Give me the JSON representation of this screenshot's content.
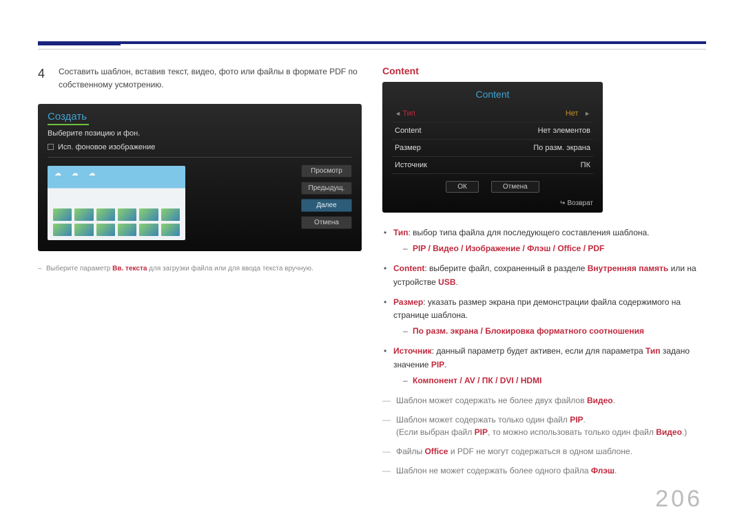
{
  "page_number": "206",
  "left": {
    "step_number": "4",
    "step_text": "Составить шаблон, вставив текст, видео, фото или файлы в формате PDF по собственному усмотрению.",
    "screen": {
      "title": "Создать",
      "instruction": "Выберите позицию и фон.",
      "checkbox_label": "Исп. фоновое изображение",
      "buttons": {
        "preview": "Просмотр",
        "prev": "Предыдущ.",
        "next": "Далее",
        "cancel": "Отмена"
      }
    },
    "caption_before_em": "Выберите параметр ",
    "caption_em": "Вв. текста",
    "caption_after_em": " для загрузки файла или для ввода текста вручную."
  },
  "right": {
    "section_title": "Content",
    "screen": {
      "title": "Content",
      "rows": {
        "type_label": "Тип",
        "type_value": "Нет",
        "content_label": "Content",
        "content_value": "Нет элементов",
        "size_label": "Размер",
        "size_value": "По разм. экрана",
        "source_label": "Источник",
        "source_value": "ПК"
      },
      "ok": "ОК",
      "cancel": "Отмена",
      "return": "Возврат"
    },
    "bullets": {
      "b1_prefix": "Тип",
      "b1_text": ": выбор типа файла для последующего составления шаблона.",
      "b1_sub": "PIP / Видео / Изображение / Флэш / Office / PDF",
      "b2_prefix": "Content",
      "b2_part1": ": выберите файл, сохраненный в разделе ",
      "b2_mem": "Внутренняя память",
      "b2_part2": " или на устройстве ",
      "b2_usb": "USB",
      "b2_end": ".",
      "b3_prefix": "Размер",
      "b3_text": ": указать размер экрана при демонстрации файла содержимого на странице шаблона.",
      "b3_sub": "По разм. экрана / Блокировка форматного соотношения",
      "b4_prefix": "Источник",
      "b4_part1": ": данный параметр будет активен, если для параметра ",
      "b4_tip": "Тип",
      "b4_part2": " задано значение ",
      "b4_pip": "PIP",
      "b4_end": ".",
      "b4_sub": "Компонент / AV / ПК / DVI / HDMI"
    },
    "notes": {
      "n1_part1": "Шаблон может содержать не более двух файлов ",
      "n1_em": "Видео",
      "n1_end": ".",
      "n2_part1": "Шаблон может содержать только один файл ",
      "n2_em": "PIP",
      "n2_end": ".",
      "n2b_part1": "(Если выбран файл ",
      "n2b_em1": "PIP",
      "n2b_part2": ", то можно использовать только один файл ",
      "n2b_em2": "Видео",
      "n2b_end": ".)",
      "n3_part1": "Файлы ",
      "n3_em": "Office",
      "n3_part2": " и PDF не могут содержаться в одном шаблоне.",
      "n4_part1": "Шаблон не может содержать более одного файла ",
      "n4_em": "Флэш",
      "n4_end": "."
    }
  }
}
